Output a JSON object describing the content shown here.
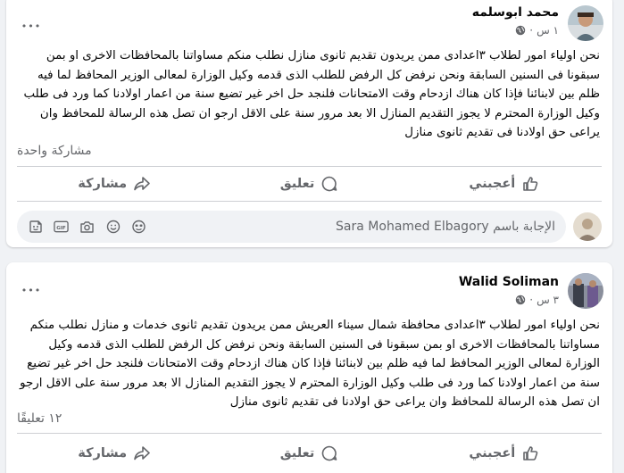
{
  "colors": {
    "background": "#f0f2f5",
    "card": "#ffffff",
    "secondary_text": "#65676b",
    "primary_text": "#050505"
  },
  "posts": [
    {
      "author": "محمد ابوسلمه",
      "time": "١ س",
      "separator": "·",
      "more_label": "•••",
      "text": "نحن اولياء امور لطلاب ٣اعدادى ممن يريدون تقديم ثانوى منازل نطلب منكم مساواتنا بالمحافظات الاخرى او بمن سبقونا فى السنين السابقة ونحن نرفض كل الرفض للطلب الذى قدمه وكيل الوزارة لمعالى الوزير المحافظ لما فيه ظلم بين لابنائنا فإذا كان هناك ازدحام وقت الامتحانات فلنجد حل اخر غير تضيع سنة من اعمار اولادنا كما ورد فى طلب وكيل الوزارة المحترم لا يجوز التقديم المنازل الا بعد مرور سنة على الاقل ارجو ان تصل هذه الرسالة للمحافظ وان يراعى حق اولادنا فى تقديم ثانوى منازل",
      "stats_text": "مشاركة واحدة",
      "actions": {
        "like": "أعجبني",
        "comment": "تعليق",
        "share": "مشاركة"
      },
      "reply_placeholder": "الإجابة باسم Sara Mohamed Elbagory",
      "reply_icons": [
        "sticker-icon",
        "gif-icon",
        "camera-icon",
        "emoji-icon",
        "avatar-sticker-icon"
      ]
    },
    {
      "author": "Walid Soliman",
      "time": "٣ س",
      "separator": "·",
      "more_label": "•••",
      "text": "نحن اولياء امور لطلاب ٣اعدادى محافظة شمال سيناء العريش ممن يريدون تقديم ثانوى خدمات و منازل نطلب منكم مساواتنا بالمحافظات الاخرى او بمن سبقونا فى السنين السابقة ونحن نرفض كل الرفض للطلب الذى قدمه وكيل الوزارة لمعالى الوزير المحافظ لما فيه ظلم بين لابنائنا فإذا كان هناك ازدحام وقت الامتحانات فلنجد حل اخر غير تضيع سنة من اعمار اولادنا كما ورد فى طلب وكيل الوزارة المحترم لا يجوز التقديم المنازل الا بعد مرور سنة على الاقل ارجو ان تصل هذه الرسالة للمحافظ وان يراعى حق اولادنا فى تقديم ثانوى منازل",
      "stats_text": "١٢ تعليقًا",
      "actions": {
        "like": "أعجبني",
        "comment": "تعليق",
        "share": "مشاركة"
      }
    }
  ]
}
